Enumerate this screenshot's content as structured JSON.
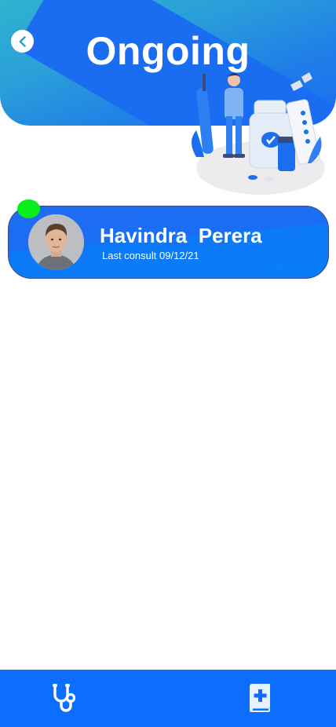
{
  "header": {
    "title": "Ongoing",
    "back_icon": "chevron-left-icon"
  },
  "colors": {
    "primary": "#0d6efd",
    "card": "#1a6ef5",
    "status_online": "#0aee1a",
    "header_gradient_start": "#2fb3cf"
  },
  "patients": [
    {
      "name": "Havindra  Perera",
      "last_consult": "Last consult 09/12/21",
      "status": "online"
    }
  ],
  "bottom_nav": {
    "items": [
      {
        "icon": "stethoscope-icon"
      },
      {
        "icon": "medical-book-icon"
      }
    ]
  }
}
